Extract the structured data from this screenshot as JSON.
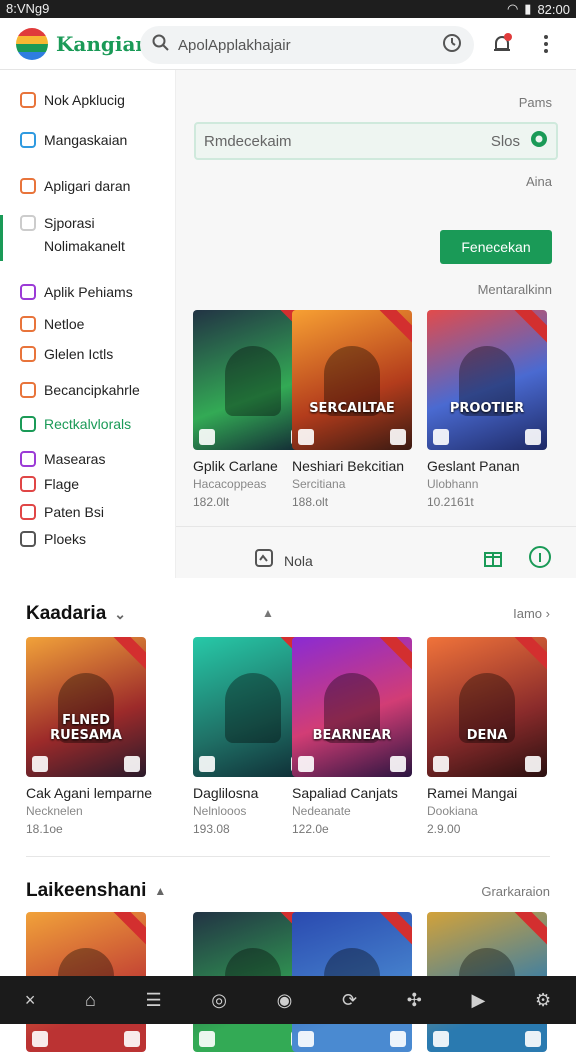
{
  "status": {
    "time": "8:VNg9",
    "right_text": "82:00"
  },
  "app": {
    "brand": "Kangiar",
    "search_placeholder": "ApolApplakhajair"
  },
  "sidebar": {
    "items": [
      {
        "label": "Nok Apklucig",
        "color": "#e8743b"
      },
      {
        "label": "Mangaskaian",
        "color": "#2f9ae0"
      },
      {
        "label": "Apligari daran",
        "color": "#e8743b"
      },
      {
        "label": "Sjporasi",
        "color": "#cccccc"
      },
      {
        "label": "Nolimakanelt",
        "color": ""
      },
      {
        "label": "Aplik Pehiams",
        "color": "#9b3bd6"
      },
      {
        "label": "Netloe",
        "color": "#e8743b"
      },
      {
        "label": "Glelen Ictls",
        "color": "#e8743b"
      },
      {
        "label": "Becancipkahrle",
        "color": "#e8743b"
      },
      {
        "label": "Rectkalvlorals",
        "color": "#1a9a57"
      },
      {
        "label": "Masearas",
        "color": "#9b3bd6"
      },
      {
        "label": "Flage",
        "color": "#e04646"
      },
      {
        "label": "Paten Bsi",
        "color": "#e04646"
      },
      {
        "label": "Ploeks",
        "color": "#555555"
      }
    ]
  },
  "main": {
    "top_right": "Pams",
    "filter_text": "Rmdecekaim",
    "filter_right": "Slos",
    "aina": "Aina",
    "button": "Fenecekan",
    "mentarakinn": "Mentaralkinn",
    "more_label": "Nola",
    "cards": [
      {
        "title": "Gplik Carlane",
        "sub": "Hacacoppeas",
        "meta": "182.0lt",
        "cap": "",
        "bg": "linear-gradient(160deg,#234 0%,#3a5 60%,#123 100%)"
      },
      {
        "title": "Neshiari Bekcitian",
        "sub": "Sercitiana",
        "meta": "188.olt",
        "cap": "SERCAILTAE",
        "bg": "linear-gradient(160deg,#f7a033 0%,#b33c1c 60%,#3a1a12 100%)"
      },
      {
        "title": "Geslant Panan",
        "sub": "Ulobhann",
        "meta": "10.2161t",
        "cap": "PROOTIER",
        "bg": "linear-gradient(160deg,#e24b4b 0%,#4a6ad1 55%,#1e2a66 100%)"
      }
    ]
  },
  "section1": {
    "title": "Kaadaria",
    "link": "Iamo",
    "cards": [
      {
        "title": "Cak Agani lemparne",
        "sub": "Necknelen",
        "meta": "18.1oe",
        "cap": "FLNED RUESAMA",
        "bg": "linear-gradient(160deg,#f1a23a 0%,#9c2a2a 60%,#2a1a2a 100%)"
      },
      {
        "title": "Daglilosna",
        "sub": "Nelnlooos",
        "meta": "193.08",
        "cap": "",
        "bg": "linear-gradient(160deg,#27c9a8 0%,#1f6f65 60%,#0e2a33 100%)"
      },
      {
        "title": "Sapaliad Canjats",
        "sub": "Nedeanate",
        "meta": "122.0e",
        "cap": "BEARNEAR",
        "bg": "linear-gradient(160deg,#8a2bd3 0%,#d23d75 55%,#2a1540 100%)"
      },
      {
        "title": "Ramei Mangai",
        "sub": "Dookiana",
        "meta": "2.9.00",
        "cap": "DENA",
        "bg": "linear-gradient(160deg,#f0733a 0%,#8a2b2b 60%,#2a1010 100%)"
      }
    ]
  },
  "section2": {
    "title": "Laikeenshani",
    "link": "Grarkaraion",
    "cards": [
      {
        "bg": "linear-gradient(160deg,#f1a23a 0%,#b33 70%)"
      },
      {
        "bg": "linear-gradient(160deg,#234 0%,#3a5 70%)"
      },
      {
        "bg": "linear-gradient(160deg,#2a4ab0 0%,#4a8ad1 70%)"
      },
      {
        "bg": "linear-gradient(160deg,#d2a23a 0%,#2a7ab0 70%)"
      }
    ]
  },
  "bottom_nav": [
    "close-icon",
    "home-icon",
    "list-icon",
    "game-icon",
    "clock-icon",
    "refresh-icon",
    "people-icon",
    "play-icon",
    "settings-icon"
  ]
}
